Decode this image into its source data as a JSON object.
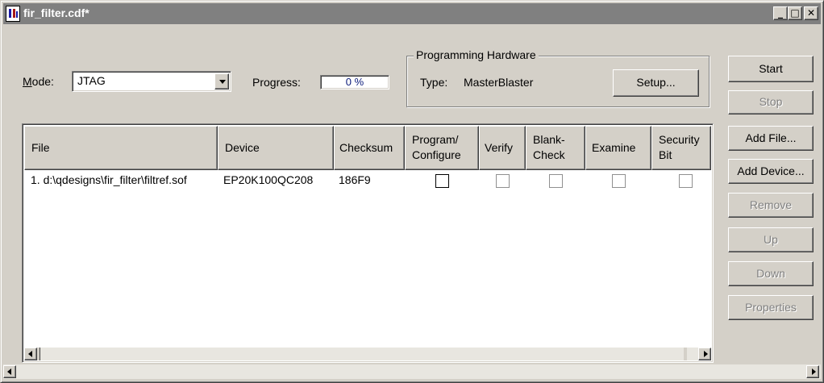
{
  "window": {
    "title": "fir_filter.cdf*",
    "controls": {
      "minimize": "_",
      "maximize": "□",
      "close": "✕"
    }
  },
  "mode": {
    "label": "Mode:",
    "value": "JTAG"
  },
  "progress": {
    "label": "Progress:",
    "value": "0 %"
  },
  "hardware": {
    "legend": "Programming Hardware",
    "type_label": "Type:",
    "type_value": "MasterBlaster",
    "setup_label": "Setup..."
  },
  "buttons": {
    "start": "Start",
    "stop": "Stop",
    "add_file": "Add File...",
    "add_device": "Add Device...",
    "remove": "Remove",
    "up": "Up",
    "down": "Down",
    "properties": "Properties"
  },
  "table": {
    "columns": [
      {
        "line1": "File",
        "line2": ""
      },
      {
        "line1": "Device",
        "line2": ""
      },
      {
        "line1": "Checksum",
        "line2": ""
      },
      {
        "line1": "Program/",
        "line2": "Configure"
      },
      {
        "line1": "Verify",
        "line2": ""
      },
      {
        "line1": "Blank-",
        "line2": "Check"
      },
      {
        "line1": "Examine",
        "line2": ""
      },
      {
        "line1": "Security",
        "line2": "Bit"
      }
    ],
    "rows": [
      {
        "file": "1. d:\\qdesigns\\fir_filter\\filtref.sof",
        "device": "EP20K100QC208",
        "checksum": "186F9",
        "program_configure": false,
        "verify": false,
        "blank_check": false,
        "examine": false,
        "security_bit": false
      }
    ]
  },
  "colors": {
    "face": "#d4d0c8",
    "title_bar": "#808080",
    "title_text": "#ffffff",
    "disabled_text": "#808080",
    "progress_text": "#0a1a7a"
  }
}
